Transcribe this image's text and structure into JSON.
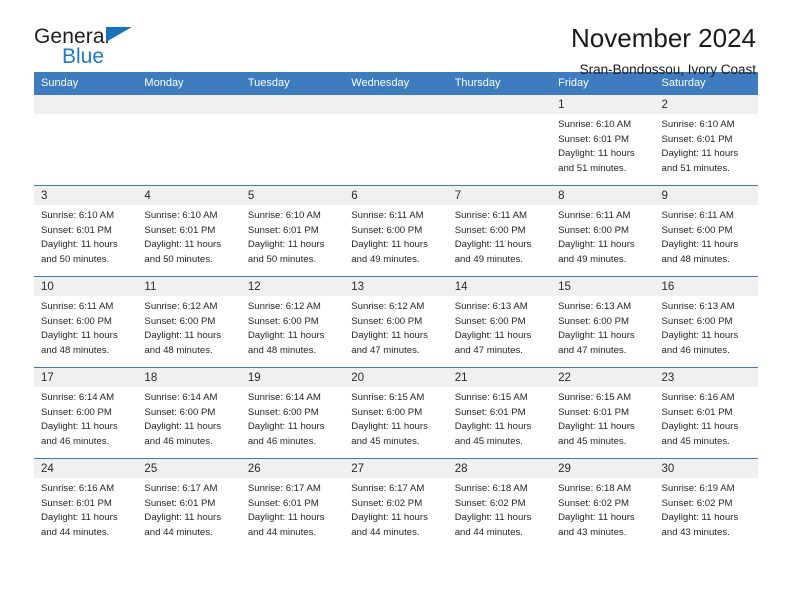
{
  "brand": {
    "name_top": "General",
    "name_bottom": "Blue",
    "accent_color": "#1b7cc4"
  },
  "header": {
    "title": "November 2024",
    "subtitle": "Sran-Bondossou, Ivory Coast"
  },
  "calendar": {
    "header_bg": "#3c7cbf",
    "daynum_bg": "#f0f0f0",
    "weekdays": [
      "Sunday",
      "Monday",
      "Tuesday",
      "Wednesday",
      "Thursday",
      "Friday",
      "Saturday"
    ],
    "weeks": [
      [
        {
          "day": "",
          "empty": true
        },
        {
          "day": "",
          "empty": true
        },
        {
          "day": "",
          "empty": true
        },
        {
          "day": "",
          "empty": true
        },
        {
          "day": "",
          "empty": true
        },
        {
          "day": "1",
          "sunrise": "Sunrise: 6:10 AM",
          "sunset": "Sunset: 6:01 PM",
          "daylight_1": "Daylight: 11 hours",
          "daylight_2": "and 51 minutes."
        },
        {
          "day": "2",
          "sunrise": "Sunrise: 6:10 AM",
          "sunset": "Sunset: 6:01 PM",
          "daylight_1": "Daylight: 11 hours",
          "daylight_2": "and 51 minutes."
        }
      ],
      [
        {
          "day": "3",
          "sunrise": "Sunrise: 6:10 AM",
          "sunset": "Sunset: 6:01 PM",
          "daylight_1": "Daylight: 11 hours",
          "daylight_2": "and 50 minutes."
        },
        {
          "day": "4",
          "sunrise": "Sunrise: 6:10 AM",
          "sunset": "Sunset: 6:01 PM",
          "daylight_1": "Daylight: 11 hours",
          "daylight_2": "and 50 minutes."
        },
        {
          "day": "5",
          "sunrise": "Sunrise: 6:10 AM",
          "sunset": "Sunset: 6:01 PM",
          "daylight_1": "Daylight: 11 hours",
          "daylight_2": "and 50 minutes."
        },
        {
          "day": "6",
          "sunrise": "Sunrise: 6:11 AM",
          "sunset": "Sunset: 6:00 PM",
          "daylight_1": "Daylight: 11 hours",
          "daylight_2": "and 49 minutes."
        },
        {
          "day": "7",
          "sunrise": "Sunrise: 6:11 AM",
          "sunset": "Sunset: 6:00 PM",
          "daylight_1": "Daylight: 11 hours",
          "daylight_2": "and 49 minutes."
        },
        {
          "day": "8",
          "sunrise": "Sunrise: 6:11 AM",
          "sunset": "Sunset: 6:00 PM",
          "daylight_1": "Daylight: 11 hours",
          "daylight_2": "and 49 minutes."
        },
        {
          "day": "9",
          "sunrise": "Sunrise: 6:11 AM",
          "sunset": "Sunset: 6:00 PM",
          "daylight_1": "Daylight: 11 hours",
          "daylight_2": "and 48 minutes."
        }
      ],
      [
        {
          "day": "10",
          "sunrise": "Sunrise: 6:11 AM",
          "sunset": "Sunset: 6:00 PM",
          "daylight_1": "Daylight: 11 hours",
          "daylight_2": "and 48 minutes."
        },
        {
          "day": "11",
          "sunrise": "Sunrise: 6:12 AM",
          "sunset": "Sunset: 6:00 PM",
          "daylight_1": "Daylight: 11 hours",
          "daylight_2": "and 48 minutes."
        },
        {
          "day": "12",
          "sunrise": "Sunrise: 6:12 AM",
          "sunset": "Sunset: 6:00 PM",
          "daylight_1": "Daylight: 11 hours",
          "daylight_2": "and 48 minutes."
        },
        {
          "day": "13",
          "sunrise": "Sunrise: 6:12 AM",
          "sunset": "Sunset: 6:00 PM",
          "daylight_1": "Daylight: 11 hours",
          "daylight_2": "and 47 minutes."
        },
        {
          "day": "14",
          "sunrise": "Sunrise: 6:13 AM",
          "sunset": "Sunset: 6:00 PM",
          "daylight_1": "Daylight: 11 hours",
          "daylight_2": "and 47 minutes."
        },
        {
          "day": "15",
          "sunrise": "Sunrise: 6:13 AM",
          "sunset": "Sunset: 6:00 PM",
          "daylight_1": "Daylight: 11 hours",
          "daylight_2": "and 47 minutes."
        },
        {
          "day": "16",
          "sunrise": "Sunrise: 6:13 AM",
          "sunset": "Sunset: 6:00 PM",
          "daylight_1": "Daylight: 11 hours",
          "daylight_2": "and 46 minutes."
        }
      ],
      [
        {
          "day": "17",
          "sunrise": "Sunrise: 6:14 AM",
          "sunset": "Sunset: 6:00 PM",
          "daylight_1": "Daylight: 11 hours",
          "daylight_2": "and 46 minutes."
        },
        {
          "day": "18",
          "sunrise": "Sunrise: 6:14 AM",
          "sunset": "Sunset: 6:00 PM",
          "daylight_1": "Daylight: 11 hours",
          "daylight_2": "and 46 minutes."
        },
        {
          "day": "19",
          "sunrise": "Sunrise: 6:14 AM",
          "sunset": "Sunset: 6:00 PM",
          "daylight_1": "Daylight: 11 hours",
          "daylight_2": "and 46 minutes."
        },
        {
          "day": "20",
          "sunrise": "Sunrise: 6:15 AM",
          "sunset": "Sunset: 6:00 PM",
          "daylight_1": "Daylight: 11 hours",
          "daylight_2": "and 45 minutes."
        },
        {
          "day": "21",
          "sunrise": "Sunrise: 6:15 AM",
          "sunset": "Sunset: 6:01 PM",
          "daylight_1": "Daylight: 11 hours",
          "daylight_2": "and 45 minutes."
        },
        {
          "day": "22",
          "sunrise": "Sunrise: 6:15 AM",
          "sunset": "Sunset: 6:01 PM",
          "daylight_1": "Daylight: 11 hours",
          "daylight_2": "and 45 minutes."
        },
        {
          "day": "23",
          "sunrise": "Sunrise: 6:16 AM",
          "sunset": "Sunset: 6:01 PM",
          "daylight_1": "Daylight: 11 hours",
          "daylight_2": "and 45 minutes."
        }
      ],
      [
        {
          "day": "24",
          "sunrise": "Sunrise: 6:16 AM",
          "sunset": "Sunset: 6:01 PM",
          "daylight_1": "Daylight: 11 hours",
          "daylight_2": "and 44 minutes."
        },
        {
          "day": "25",
          "sunrise": "Sunrise: 6:17 AM",
          "sunset": "Sunset: 6:01 PM",
          "daylight_1": "Daylight: 11 hours",
          "daylight_2": "and 44 minutes."
        },
        {
          "day": "26",
          "sunrise": "Sunrise: 6:17 AM",
          "sunset": "Sunset: 6:01 PM",
          "daylight_1": "Daylight: 11 hours",
          "daylight_2": "and 44 minutes."
        },
        {
          "day": "27",
          "sunrise": "Sunrise: 6:17 AM",
          "sunset": "Sunset: 6:02 PM",
          "daylight_1": "Daylight: 11 hours",
          "daylight_2": "and 44 minutes."
        },
        {
          "day": "28",
          "sunrise": "Sunrise: 6:18 AM",
          "sunset": "Sunset: 6:02 PM",
          "daylight_1": "Daylight: 11 hours",
          "daylight_2": "and 44 minutes."
        },
        {
          "day": "29",
          "sunrise": "Sunrise: 6:18 AM",
          "sunset": "Sunset: 6:02 PM",
          "daylight_1": "Daylight: 11 hours",
          "daylight_2": "and 43 minutes."
        },
        {
          "day": "30",
          "sunrise": "Sunrise: 6:19 AM",
          "sunset": "Sunset: 6:02 PM",
          "daylight_1": "Daylight: 11 hours",
          "daylight_2": "and 43 minutes."
        }
      ]
    ]
  }
}
